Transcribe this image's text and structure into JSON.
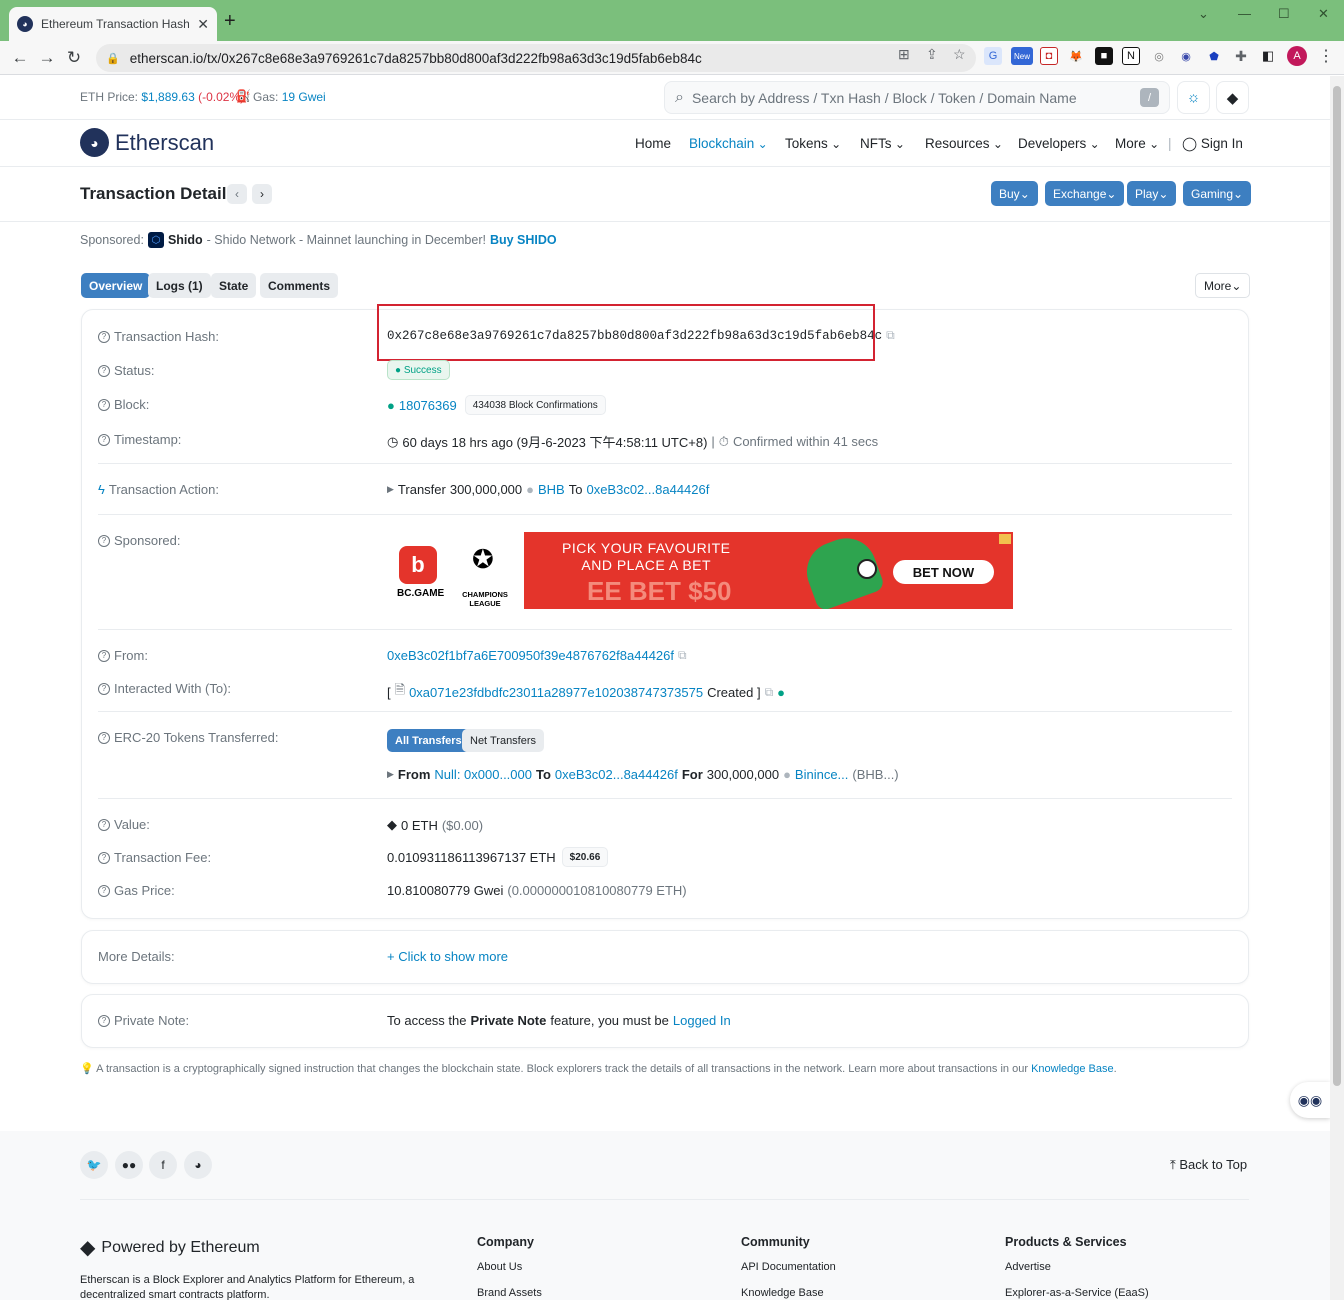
{
  "browser": {
    "tab_title": "Ethereum Transaction Hash (Tx...",
    "tab_close": "✕",
    "new_tab": "+",
    "url": "etherscan.io/tx/0x267c8e68e3a9769261c7da8257bb80d800af3d222fb98a63d3c19d5fab6eb84c",
    "avatar_initial": "A",
    "ext_new_label": "New"
  },
  "topbar": {
    "eth_price_label": "ETH Price:",
    "eth_price_value": "$1,889.63",
    "eth_price_change": "(-0.02%)",
    "gas_label": "Gas:",
    "gas_value": "19 Gwei",
    "search_placeholder": "Search by Address / Txn Hash / Block / Token / Domain Name",
    "search_shortcut": "/"
  },
  "nav": {
    "brand": "Etherscan",
    "items": [
      "Home",
      "Blockchain",
      "Tokens",
      "NFTs",
      "Resources",
      "Developers",
      "More"
    ],
    "sign_in": "Sign In"
  },
  "subheader": {
    "title": "Transaction Details",
    "buttons": [
      "Buy",
      "Exchange",
      "Play",
      "Gaming"
    ]
  },
  "sponsored_top": {
    "label": "Sponsored:",
    "name": "Shido",
    "text": "- Shido Network - Mainnet launching in December!",
    "cta": "Buy SHIDO"
  },
  "tabs": [
    "Overview",
    "Logs (1)",
    "State",
    "Comments"
  ],
  "more_menu": "More",
  "details": {
    "tx_hash_label": "Transaction Hash:",
    "tx_hash": "0x267c8e68e3a9769261c7da8257bb80d800af3d222fb98a63d3c19d5fab6eb84c",
    "status_label": "Status:",
    "status": "Success",
    "block_label": "Block:",
    "block": "18076369",
    "confirmations": "434038 Block Confirmations",
    "timestamp_label": "Timestamp:",
    "timestamp": "60 days 18 hrs ago (9月-6-2023 下午4:58:11 UTC+8)",
    "confirmed_within": "Confirmed within 41 secs",
    "action_label": "Transaction Action:",
    "action_prefix": "Transfer",
    "action_amount": "300,000,000",
    "action_token": "BHB",
    "action_to_word": "To",
    "action_to_addr": "0xeB3c02...8a44426f",
    "sponsored_label": "Sponsored:",
    "from_label": "From:",
    "from": "0xeB3c02f1bf7a6E700950f39e4876762f8a44426f",
    "to_label": "Interacted With (To):",
    "to_bracket_open": "[",
    "to_addr": "0xa071e23fdbdfc23011a28977e102038747373575",
    "to_created": "Created ]",
    "erc20_label": "ERC-20 Tokens Transferred:",
    "erc20_tabs": [
      "All Transfers",
      "Net Transfers"
    ],
    "erc20_from_word": "From",
    "erc20_from": "Null: 0x000...000",
    "erc20_to_word": "To",
    "erc20_to": "0xeB3c02...8a44426f",
    "erc20_for_word": "For",
    "erc20_amount": "300,000,000",
    "erc20_token": "Binince...",
    "erc20_token_sym": "(BHB...)",
    "value_label": "Value:",
    "value": "0 ETH",
    "value_usd": "($0.00)",
    "fee_label": "Transaction Fee:",
    "fee": "0.010931186113967137 ETH",
    "fee_usd": "$20.66",
    "gas_price_label": "Gas Price:",
    "gas_price": "10.810080779 Gwei",
    "gas_price_eth": "(0.000000010810080779 ETH)"
  },
  "ad": {
    "brand": "BC.GAME",
    "league": "CHAMPIONS LEAGUE",
    "headline_1": "PICK YOUR FAVOURITE",
    "headline_2": "AND PLACE A BET",
    "bottom": "EE BET $50",
    "cta": "BET NOW"
  },
  "more_details": {
    "label": "More Details:",
    "link": "+ Click to show more"
  },
  "private_note": {
    "label": "Private Note:",
    "text_1": "To access the",
    "bold": "Private Note",
    "text_2": "feature, you must be",
    "link": "Logged In"
  },
  "footnote": {
    "text": "A transaction is a cryptographically signed instruction that changes the blockchain state. Block explorers track the details of all transactions in the network. Learn more about transactions in our",
    "link": "Knowledge Base",
    "period": "."
  },
  "footer": {
    "back_to_top": "Back to Top",
    "powered": "Powered by Ethereum",
    "description": "Etherscan is a Block Explorer and Analytics Platform for Ethereum, a decentralized smart contracts platform.",
    "columns": [
      {
        "title": "Company",
        "links": [
          "About Us",
          "Brand Assets"
        ]
      },
      {
        "title": "Community",
        "links": [
          "API Documentation",
          "Knowledge Base"
        ]
      },
      {
        "title": "Products & Services",
        "links": [
          "Advertise",
          "Explorer-as-a-Service (EaaS)"
        ]
      }
    ]
  },
  "colors": {
    "link": "#0784c3",
    "accent": "#3d7fc1",
    "success": "#00a186",
    "highlight": "#d32331",
    "tabstrip": "#7bbf7c"
  }
}
